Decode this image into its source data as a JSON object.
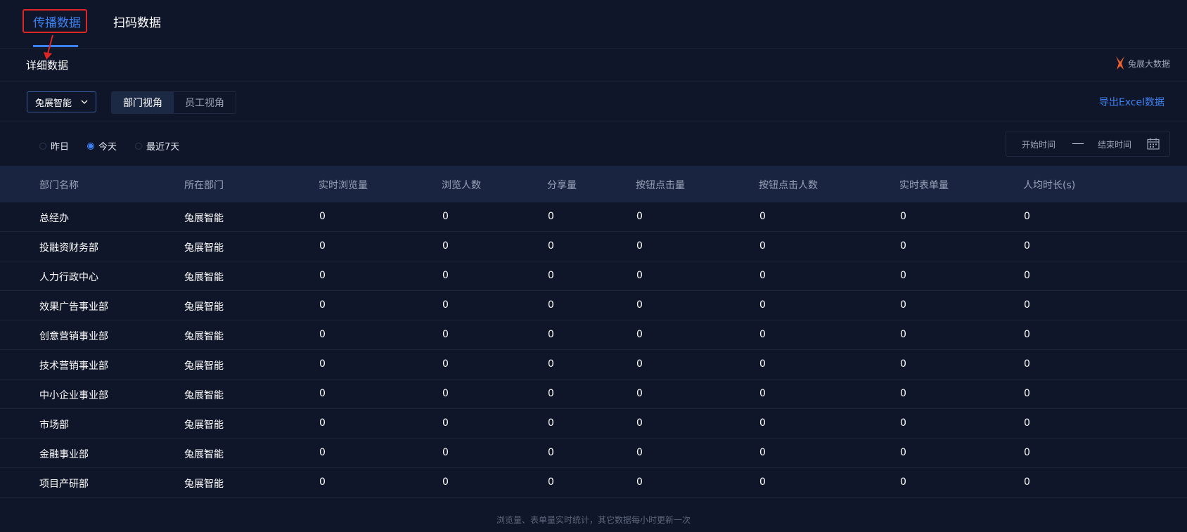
{
  "tabs": [
    {
      "label": "传播数据",
      "active": true
    },
    {
      "label": "扫码数据",
      "active": false
    }
  ],
  "section": {
    "title": "详细数据",
    "brand_text": "兔展大数据"
  },
  "toolbar": {
    "company_select": "兔展智能",
    "views": [
      {
        "label": "部门视角",
        "active": true
      },
      {
        "label": "员工视角",
        "active": false
      }
    ],
    "export_label": "导出Excel数据"
  },
  "filters": {
    "ranges": [
      {
        "label": "昨日",
        "checked": false
      },
      {
        "label": "今天",
        "checked": true
      },
      {
        "label": "最近7天",
        "checked": false
      }
    ],
    "start_placeholder": "开始时间",
    "end_placeholder": "结束时间"
  },
  "table": {
    "columns": [
      "部门名称",
      "所在部门",
      "实时浏览量",
      "浏览人数",
      "分享量",
      "按钮点击量",
      "按钮点击人数",
      "实时表单量",
      "人均时长(s)"
    ],
    "rows": [
      [
        "总经办",
        "兔展智能",
        "0",
        "0",
        "0",
        "0",
        "0",
        "0",
        "0"
      ],
      [
        "投融资财务部",
        "兔展智能",
        "0",
        "0",
        "0",
        "0",
        "0",
        "0",
        "0"
      ],
      [
        "人力行政中心",
        "兔展智能",
        "0",
        "0",
        "0",
        "0",
        "0",
        "0",
        "0"
      ],
      [
        "效果广告事业部",
        "兔展智能",
        "0",
        "0",
        "0",
        "0",
        "0",
        "0",
        "0"
      ],
      [
        "创意营销事业部",
        "兔展智能",
        "0",
        "0",
        "0",
        "0",
        "0",
        "0",
        "0"
      ],
      [
        "技术营销事业部",
        "兔展智能",
        "0",
        "0",
        "0",
        "0",
        "0",
        "0",
        "0"
      ],
      [
        "中小企业事业部",
        "兔展智能",
        "0",
        "0",
        "0",
        "0",
        "0",
        "0",
        "0"
      ],
      [
        "市场部",
        "兔展智能",
        "0",
        "0",
        "0",
        "0",
        "0",
        "0",
        "0"
      ],
      [
        "金融事业部",
        "兔展智能",
        "0",
        "0",
        "0",
        "0",
        "0",
        "0",
        "0"
      ],
      [
        "项目产研部",
        "兔展智能",
        "0",
        "0",
        "0",
        "0",
        "0",
        "0",
        "0"
      ]
    ]
  },
  "footnote": "浏览量、表单量实时统计，其它数据每小时更新一次",
  "colors": {
    "background": "#101629",
    "accent": "#3d82f2",
    "highlight": "#e02525",
    "header_row": "#182440"
  }
}
